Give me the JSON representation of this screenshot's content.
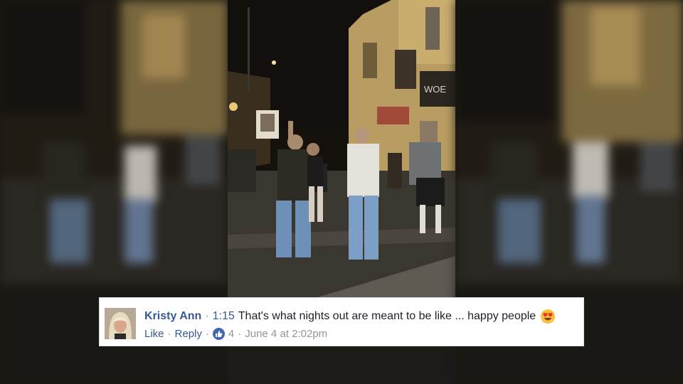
{
  "comment": {
    "author": "Kristy Ann",
    "separator_dot": "·",
    "timestamp": "1:15",
    "text": "That's what nights out are meant to be like ... happy people",
    "emoji_icon": "heart-eyes-emoji",
    "actions": {
      "like_label": "Like",
      "reply_label": "Reply",
      "like_count": "4",
      "date": "June 4 at 2:02pm"
    }
  },
  "colors": {
    "link_blue": "#365899",
    "meta_gray": "#90949c",
    "like_badge": "#4267b2"
  }
}
